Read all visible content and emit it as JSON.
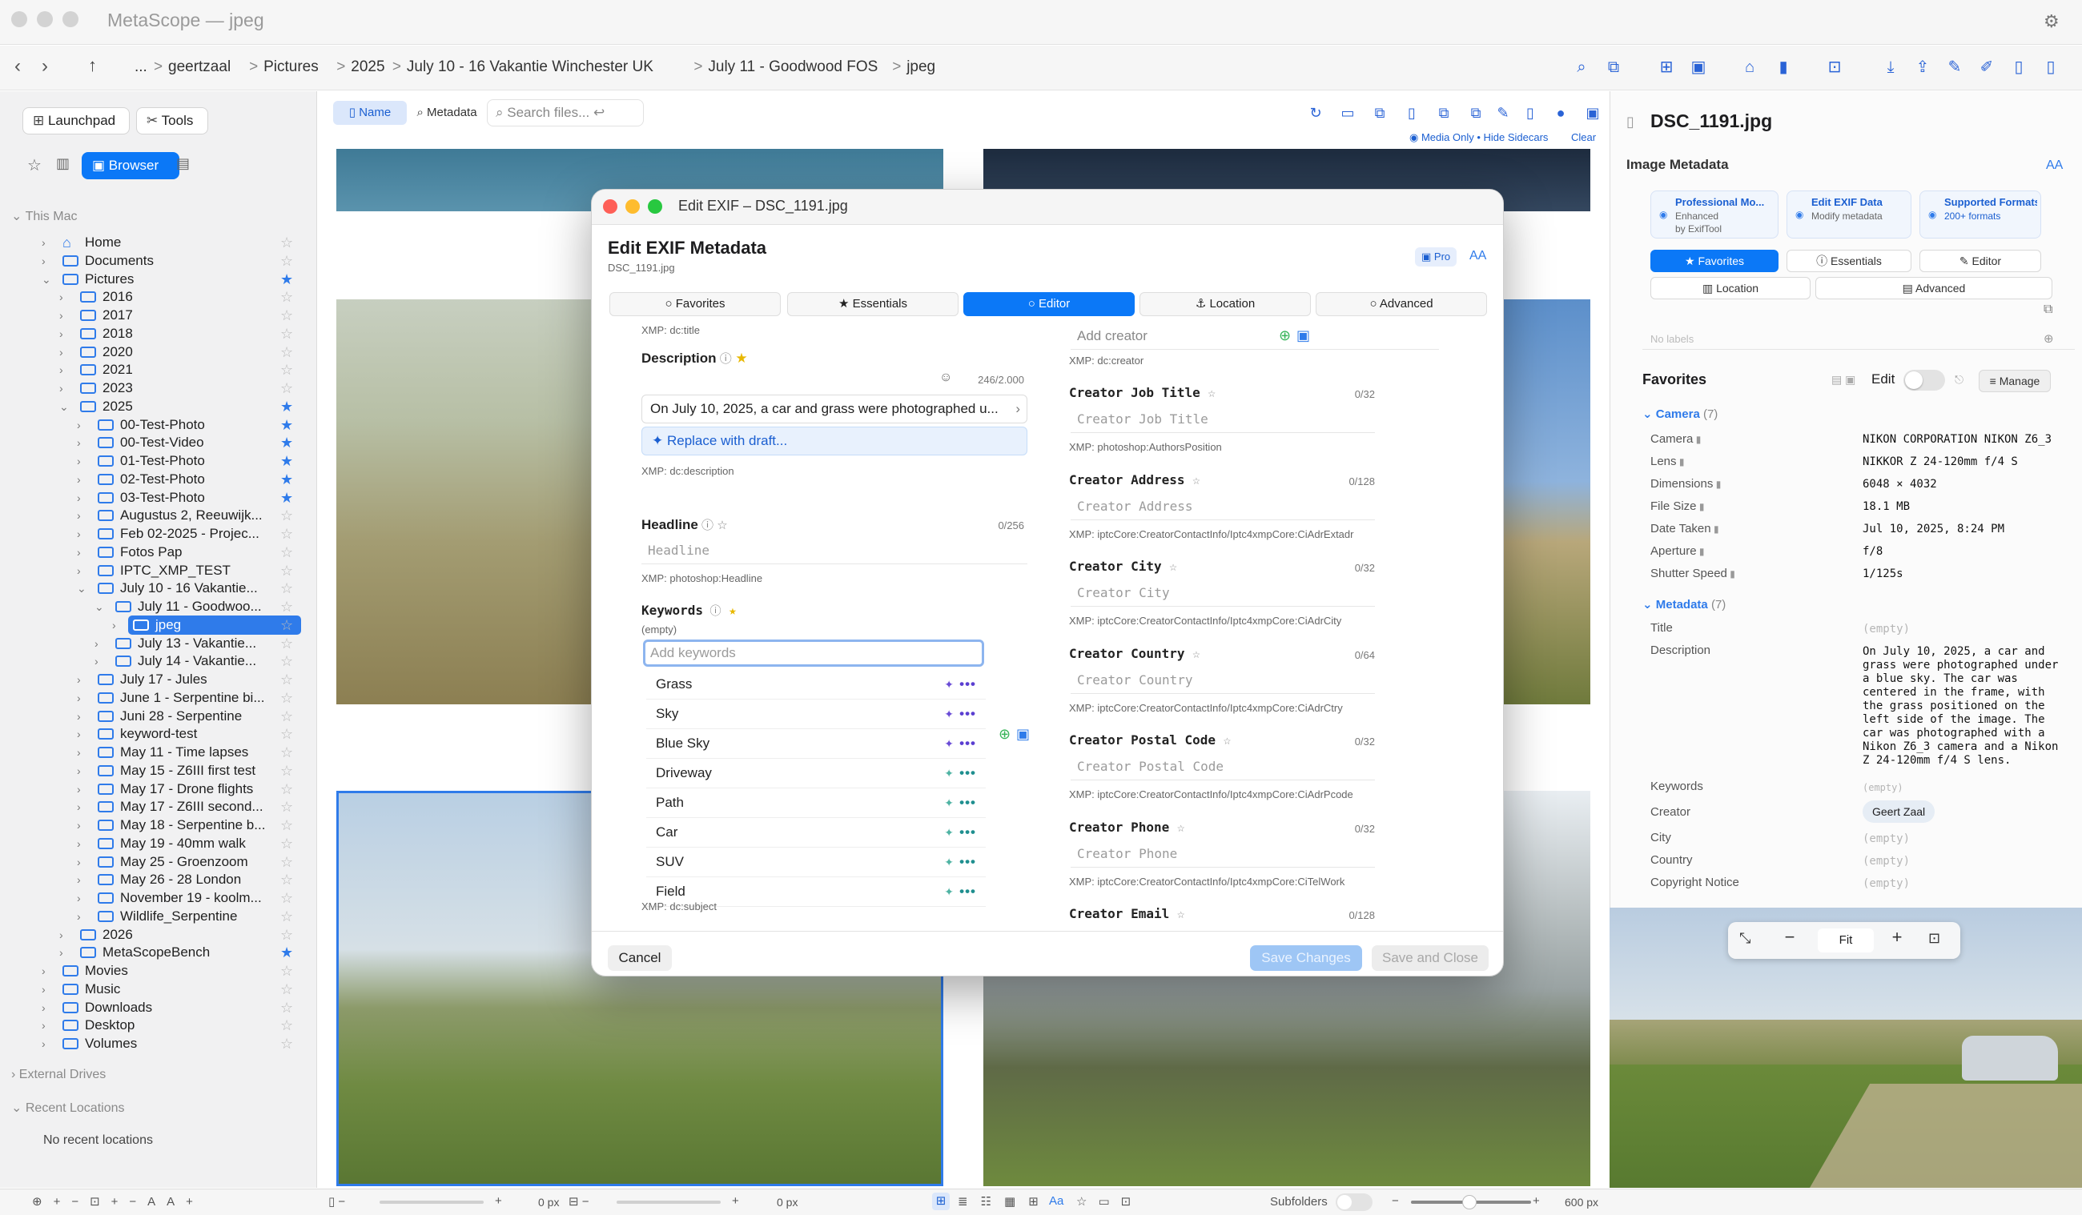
{
  "app": {
    "title": "MetaScope — jpeg"
  },
  "path": {
    "ellipsis": "...",
    "segments": [
      "geertzaal",
      "Pictures",
      "2025",
      "July 10 - 16 Vakantie Winchester UK",
      "July 11 - Goodwood FOS",
      "jpeg"
    ],
    "sep": ">"
  },
  "sidebar": {
    "launchpad": "Launchpad",
    "tools": "Tools",
    "browser": "Browser",
    "this_mac": "This Mac",
    "external": "External Drives",
    "recent": "Recent Locations",
    "no_recent": "No recent locations",
    "tree": [
      {
        "label": "Home",
        "d": 0,
        "c": "closed",
        "star": false
      },
      {
        "label": "Documents",
        "d": 0,
        "c": "closed",
        "star": false
      },
      {
        "label": "Pictures",
        "d": 0,
        "c": "open",
        "star": true
      },
      {
        "label": "2016",
        "d": 1,
        "c": "closed",
        "star": false
      },
      {
        "label": "2017",
        "d": 1,
        "c": "closed",
        "star": false
      },
      {
        "label": "2018",
        "d": 1,
        "c": "closed",
        "star": false
      },
      {
        "label": "2020",
        "d": 1,
        "c": "closed",
        "star": false
      },
      {
        "label": "2021",
        "d": 1,
        "c": "closed",
        "star": false
      },
      {
        "label": "2023",
        "d": 1,
        "c": "closed",
        "star": false
      },
      {
        "label": "2025",
        "d": 1,
        "c": "open",
        "star": true
      },
      {
        "label": "00-Test-Photo",
        "d": 2,
        "c": "closed",
        "star": true
      },
      {
        "label": "00-Test-Video",
        "d": 2,
        "c": "closed",
        "star": true
      },
      {
        "label": "01-Test-Photo",
        "d": 2,
        "c": "closed",
        "star": true
      },
      {
        "label": "02-Test-Photo",
        "d": 2,
        "c": "closed",
        "star": true
      },
      {
        "label": "03-Test-Photo",
        "d": 2,
        "c": "closed",
        "star": true
      },
      {
        "label": "Augustus 2, Reeuwijk...",
        "d": 2,
        "c": "closed",
        "star": false
      },
      {
        "label": "Feb 02-2025 - Projec...",
        "d": 2,
        "c": "closed",
        "star": false
      },
      {
        "label": "Fotos Pap",
        "d": 2,
        "c": "closed",
        "star": false
      },
      {
        "label": "IPTC_XMP_TEST",
        "d": 2,
        "c": "closed",
        "star": false
      },
      {
        "label": "July 10 - 16 Vakantie...",
        "d": 2,
        "c": "open",
        "star": false
      },
      {
        "label": "July 11 - Goodwoo...",
        "d": 3,
        "c": "open",
        "star": false
      },
      {
        "label": "jpeg",
        "d": 4,
        "c": "closed",
        "star": false,
        "sel": true
      },
      {
        "label": "July 13 - Vakantie...",
        "d": 3,
        "c": "closed",
        "star": false
      },
      {
        "label": "July 14 - Vakantie...",
        "d": 3,
        "c": "closed",
        "star": false
      },
      {
        "label": "July 17 - Jules",
        "d": 2,
        "c": "closed",
        "star": false
      },
      {
        "label": "June 1 - Serpentine bi...",
        "d": 2,
        "c": "closed",
        "star": false
      },
      {
        "label": "Juni 28 - Serpentine",
        "d": 2,
        "c": "closed",
        "star": false
      },
      {
        "label": "keyword-test",
        "d": 2,
        "c": "closed",
        "star": false
      },
      {
        "label": "May 11 - Time lapses",
        "d": 2,
        "c": "closed",
        "star": false
      },
      {
        "label": "May 15 - Z6III first test",
        "d": 2,
        "c": "closed",
        "star": false
      },
      {
        "label": "May 17 - Drone flights",
        "d": 2,
        "c": "closed",
        "star": false
      },
      {
        "label": "May 17 - Z6III second...",
        "d": 2,
        "c": "closed",
        "star": false
      },
      {
        "label": "May 18 - Serpentine b...",
        "d": 2,
        "c": "closed",
        "star": false
      },
      {
        "label": "May 19 - 40mm walk",
        "d": 2,
        "c": "closed",
        "star": false
      },
      {
        "label": "May 25 - Groenzoom",
        "d": 2,
        "c": "closed",
        "star": false
      },
      {
        "label": "May 26 - 28 London",
        "d": 2,
        "c": "closed",
        "star": false
      },
      {
        "label": "November 19 - koolm...",
        "d": 2,
        "c": "closed",
        "star": false
      },
      {
        "label": "Wildlife_Serpentine",
        "d": 2,
        "c": "closed",
        "star": false
      },
      {
        "label": "2026",
        "d": 1,
        "c": "closed",
        "star": false
      },
      {
        "label": "MetaScopeBench",
        "d": 1,
        "c": "closed",
        "star": true
      },
      {
        "label": "Movies",
        "d": 0,
        "c": "closed",
        "star": false
      },
      {
        "label": "Music",
        "d": 0,
        "c": "closed",
        "star": false
      },
      {
        "label": "Downloads",
        "d": 0,
        "c": "closed",
        "star": false
      },
      {
        "label": "Desktop",
        "d": 0,
        "c": "closed",
        "star": false
      },
      {
        "label": "Volumes",
        "d": 0,
        "c": "closed",
        "star": false
      }
    ]
  },
  "toolbar": {
    "name": "Name",
    "metadata": "Metadata",
    "search_placeholder": "Search files... ↩",
    "media_only": "Media Only • Hide Sidecars",
    "clear": "Clear"
  },
  "dialog": {
    "window_title": "Edit EXIF – DSC_1191.jpg",
    "heading": "Edit EXIF Metadata",
    "file": "DSC_1191.jpg",
    "pro": "Pro",
    "aa": "AA",
    "tabs": [
      "Favorites",
      "Essentials",
      "Editor",
      "Location",
      "Advanced"
    ],
    "left": {
      "title_xmp": "XMP: dc:title",
      "desc_label": "Description",
      "desc_count": "246/2.000",
      "desc_value": "On July 10, 2025, a car and grass were photographed u...",
      "replace": "Replace with draft...",
      "desc_xmp": "XMP: dc:description",
      "headline_label": "Headline",
      "headline_count": "0/256",
      "headline_ph": "Headline",
      "headline_xmp": "XMP: photoshop:Headline",
      "kw_label": "Keywords",
      "kw_empty": "(empty)",
      "kw_ph": "Add keywords",
      "kw_list": [
        "Grass",
        "Sky",
        "Blue Sky",
        "Driveway",
        "Path",
        "Car",
        "SUV",
        "Field"
      ],
      "kw_xmp": "XMP: dc:subject"
    },
    "right": {
      "creator_ph": "Add creator",
      "creator_xmp": "XMP: dc:creator",
      "fields": [
        {
          "label": "Creator Job Title",
          "count": "0/32",
          "ph": "Creator Job Title",
          "xmp": "XMP: photoshop:AuthorsPosition"
        },
        {
          "label": "Creator Address",
          "count": "0/128",
          "ph": "Creator Address",
          "xmp": "XMP: iptcCore:CreatorContactInfo/Iptc4xmpCore:CiAdrExtadr"
        },
        {
          "label": "Creator City",
          "count": "0/32",
          "ph": "Creator City",
          "xmp": "XMP: iptcCore:CreatorContactInfo/Iptc4xmpCore:CiAdrCity"
        },
        {
          "label": "Creator Country",
          "count": "0/64",
          "ph": "Creator Country",
          "xmp": "XMP: iptcCore:CreatorContactInfo/Iptc4xmpCore:CiAdrCtry"
        },
        {
          "label": "Creator Postal Code",
          "count": "0/32",
          "ph": "Creator Postal Code",
          "xmp": "XMP: iptcCore:CreatorContactInfo/Iptc4xmpCore:CiAdrPcode"
        },
        {
          "label": "Creator Phone",
          "count": "0/32",
          "ph": "Creator Phone",
          "xmp": "XMP: iptcCore:CreatorContactInfo/Iptc4xmpCore:CiTelWork"
        },
        {
          "label": "Creator Email",
          "count": "0/128",
          "ph": "",
          "xmp": ""
        }
      ]
    },
    "cancel": "Cancel",
    "save": "Save Changes",
    "save_close": "Save and Close"
  },
  "inspector": {
    "filename": "DSC_1191.jpg",
    "section": "Image Metadata",
    "aa": "AA",
    "cards": [
      {
        "t": "Professional Mo...",
        "s1": "Enhanced",
        "s2": "by ExifTool"
      },
      {
        "t": "Edit EXIF Data",
        "s1": "Modify metadata",
        "s2": ""
      },
      {
        "t": "Supported Formats",
        "s1": "200+ formats",
        "s2": ""
      }
    ],
    "tabs": [
      "Favorites",
      "Essentials",
      "Editor",
      "Location",
      "Advanced"
    ],
    "labels_ph": "No labels",
    "favorites": "Favorites",
    "edit": "Edit",
    "manage": "Manage",
    "camera_group": "Camera",
    "camera_count": "(7)",
    "camera": [
      {
        "k": "Camera",
        "v": "NIKON CORPORATION NIKON Z6_3"
      },
      {
        "k": "Lens",
        "v": "NIKKOR Z 24-120mm f/4 S"
      },
      {
        "k": "Dimensions",
        "v": "6048 × 4032"
      },
      {
        "k": "File Size",
        "v": "18.1 MB"
      },
      {
        "k": "Date Taken",
        "v": "Jul 10, 2025, 8:24 PM"
      },
      {
        "k": "Aperture",
        "v": "f/8"
      },
      {
        "k": "Shutter Speed",
        "v": "1/125s"
      }
    ],
    "meta_group": "Metadata",
    "meta_count": "(7)",
    "title_k": "Title",
    "empty": "(empty)",
    "desc_k": "Description",
    "desc_v": "On July 10, 2025, a car and\ngrass were photographed under\na blue sky. The car was\ncentered in the frame, with\nthe grass positioned on the\nleft side of the image. The\ncar was photographed with a\nNikon Z6_3 camera and a Nikon\nZ 24-120mm f/4 S lens.",
    "kw_k": "Keywords",
    "creator_k": "Creator",
    "creator_v": "Geert Zaal",
    "city_k": "City",
    "country_k": "Country",
    "copyright_k": "Copyright Notice"
  },
  "preview": {
    "fit": "Fit"
  },
  "statusbar": {
    "px1": "0 px",
    "px2": "0 px",
    "subfolders": "Subfolders",
    "zoom": "600 px"
  }
}
